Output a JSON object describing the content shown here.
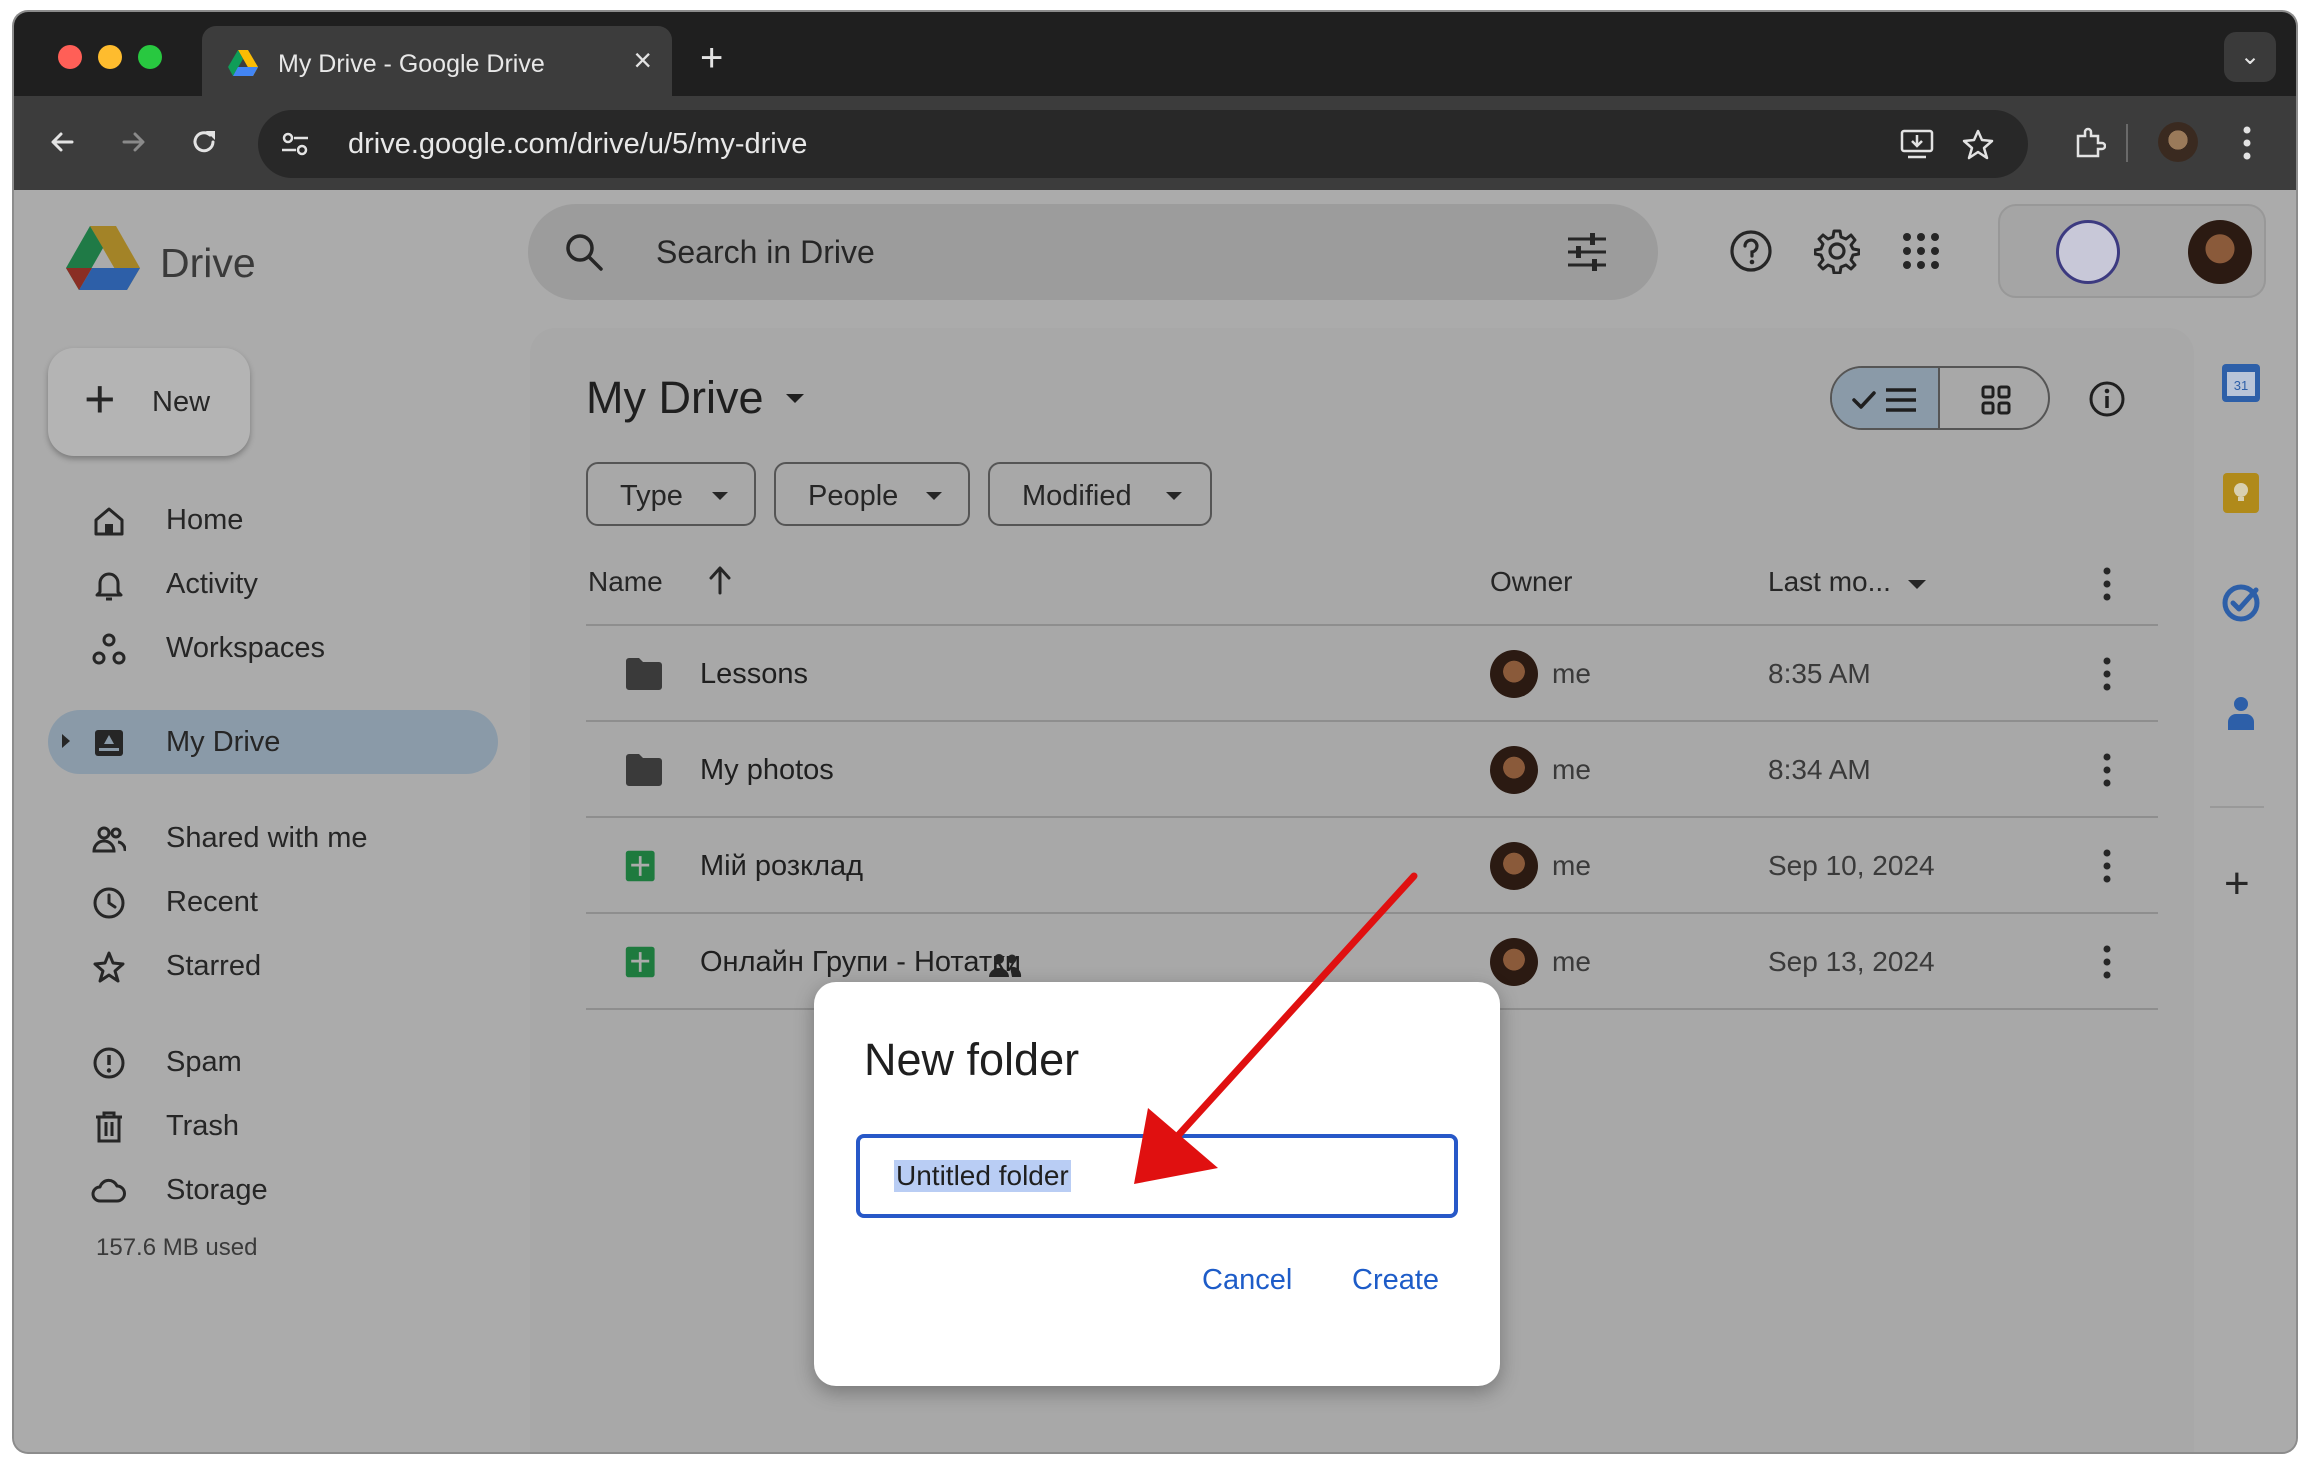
{
  "browser": {
    "tab_title": "My Drive - Google Drive",
    "url": "drive.google.com/drive/u/5/my-drive"
  },
  "app": {
    "brand": "Drive",
    "search_placeholder": "Search in Drive",
    "new_button": "New"
  },
  "sidebar": {
    "items": [
      {
        "label": "Home",
        "icon": "home-icon"
      },
      {
        "label": "Activity",
        "icon": "bell-icon"
      },
      {
        "label": "Workspaces",
        "icon": "workspaces-icon"
      },
      {
        "label": "My Drive",
        "icon": "my-drive-icon",
        "active": true
      },
      {
        "label": "Shared with me",
        "icon": "people-icon"
      },
      {
        "label": "Recent",
        "icon": "clock-icon"
      },
      {
        "label": "Starred",
        "icon": "star-icon"
      },
      {
        "label": "Spam",
        "icon": "spam-icon"
      },
      {
        "label": "Trash",
        "icon": "trash-icon"
      },
      {
        "label": "Storage",
        "icon": "cloud-icon"
      }
    ],
    "storage_used": "157.6 MB used"
  },
  "main": {
    "title": "My Drive",
    "filters": [
      "Type",
      "People",
      "Modified"
    ],
    "columns": {
      "name": "Name",
      "owner": "Owner",
      "modified": "Last mo..."
    },
    "files": [
      {
        "name": "Lessons",
        "type": "folder",
        "owner": "me",
        "modified": "8:35 AM"
      },
      {
        "name": "My photos",
        "type": "folder",
        "owner": "me",
        "modified": "8:34 AM"
      },
      {
        "name": "Мій розклад",
        "type": "sheet",
        "owner": "me",
        "modified": "Sep 10, 2024"
      },
      {
        "name": "Онлайн Групи - Нотатки",
        "type": "sheet",
        "owner": "me",
        "modified": "Sep 13, 2024",
        "shared": true
      }
    ]
  },
  "dialog": {
    "title": "New folder",
    "input_value": "Untitled folder",
    "cancel": "Cancel",
    "create": "Create"
  },
  "colors": {
    "accent": "#1d5cc8",
    "annotation_arrow": "#e01010",
    "sheet_green": "#1e8e3e"
  }
}
